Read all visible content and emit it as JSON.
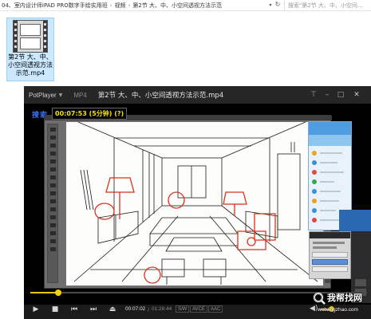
{
  "explorer": {
    "breadcrumbs": [
      "04、室内设计师IPAD PRO数字手绘实用班",
      "视频",
      "第2节 大、中、小空间透视方法示范"
    ],
    "search_placeholder": "搜索\"第2节 大、中、小空间...",
    "file": {
      "name_line1": "第2节 大、中、",
      "name_line2": "小空间透视方法",
      "name_line3": "示范.mp4"
    }
  },
  "player": {
    "brand": "PotPlayer",
    "format": "MP4",
    "filename": "第2节 大、中、小空间透视方法示范.mp4",
    "overlay_search": "搜索",
    "overlay_time": "00:07:53 (5分钟) (?)",
    "time_current": "00:07:02",
    "time_separator": "/",
    "time_total": "01:28:44",
    "tags": [
      "S/W",
      "AVCE",
      "AAC"
    ],
    "progress_fraction": 0.082,
    "volume_fraction": 0.45
  },
  "watermark": {
    "name": "我帮找网",
    "url": "wobangzhao.com"
  },
  "colors": {
    "accent": "#e9c20b",
    "sketch_red": "#d8321e",
    "selection": "#cce8ff"
  }
}
